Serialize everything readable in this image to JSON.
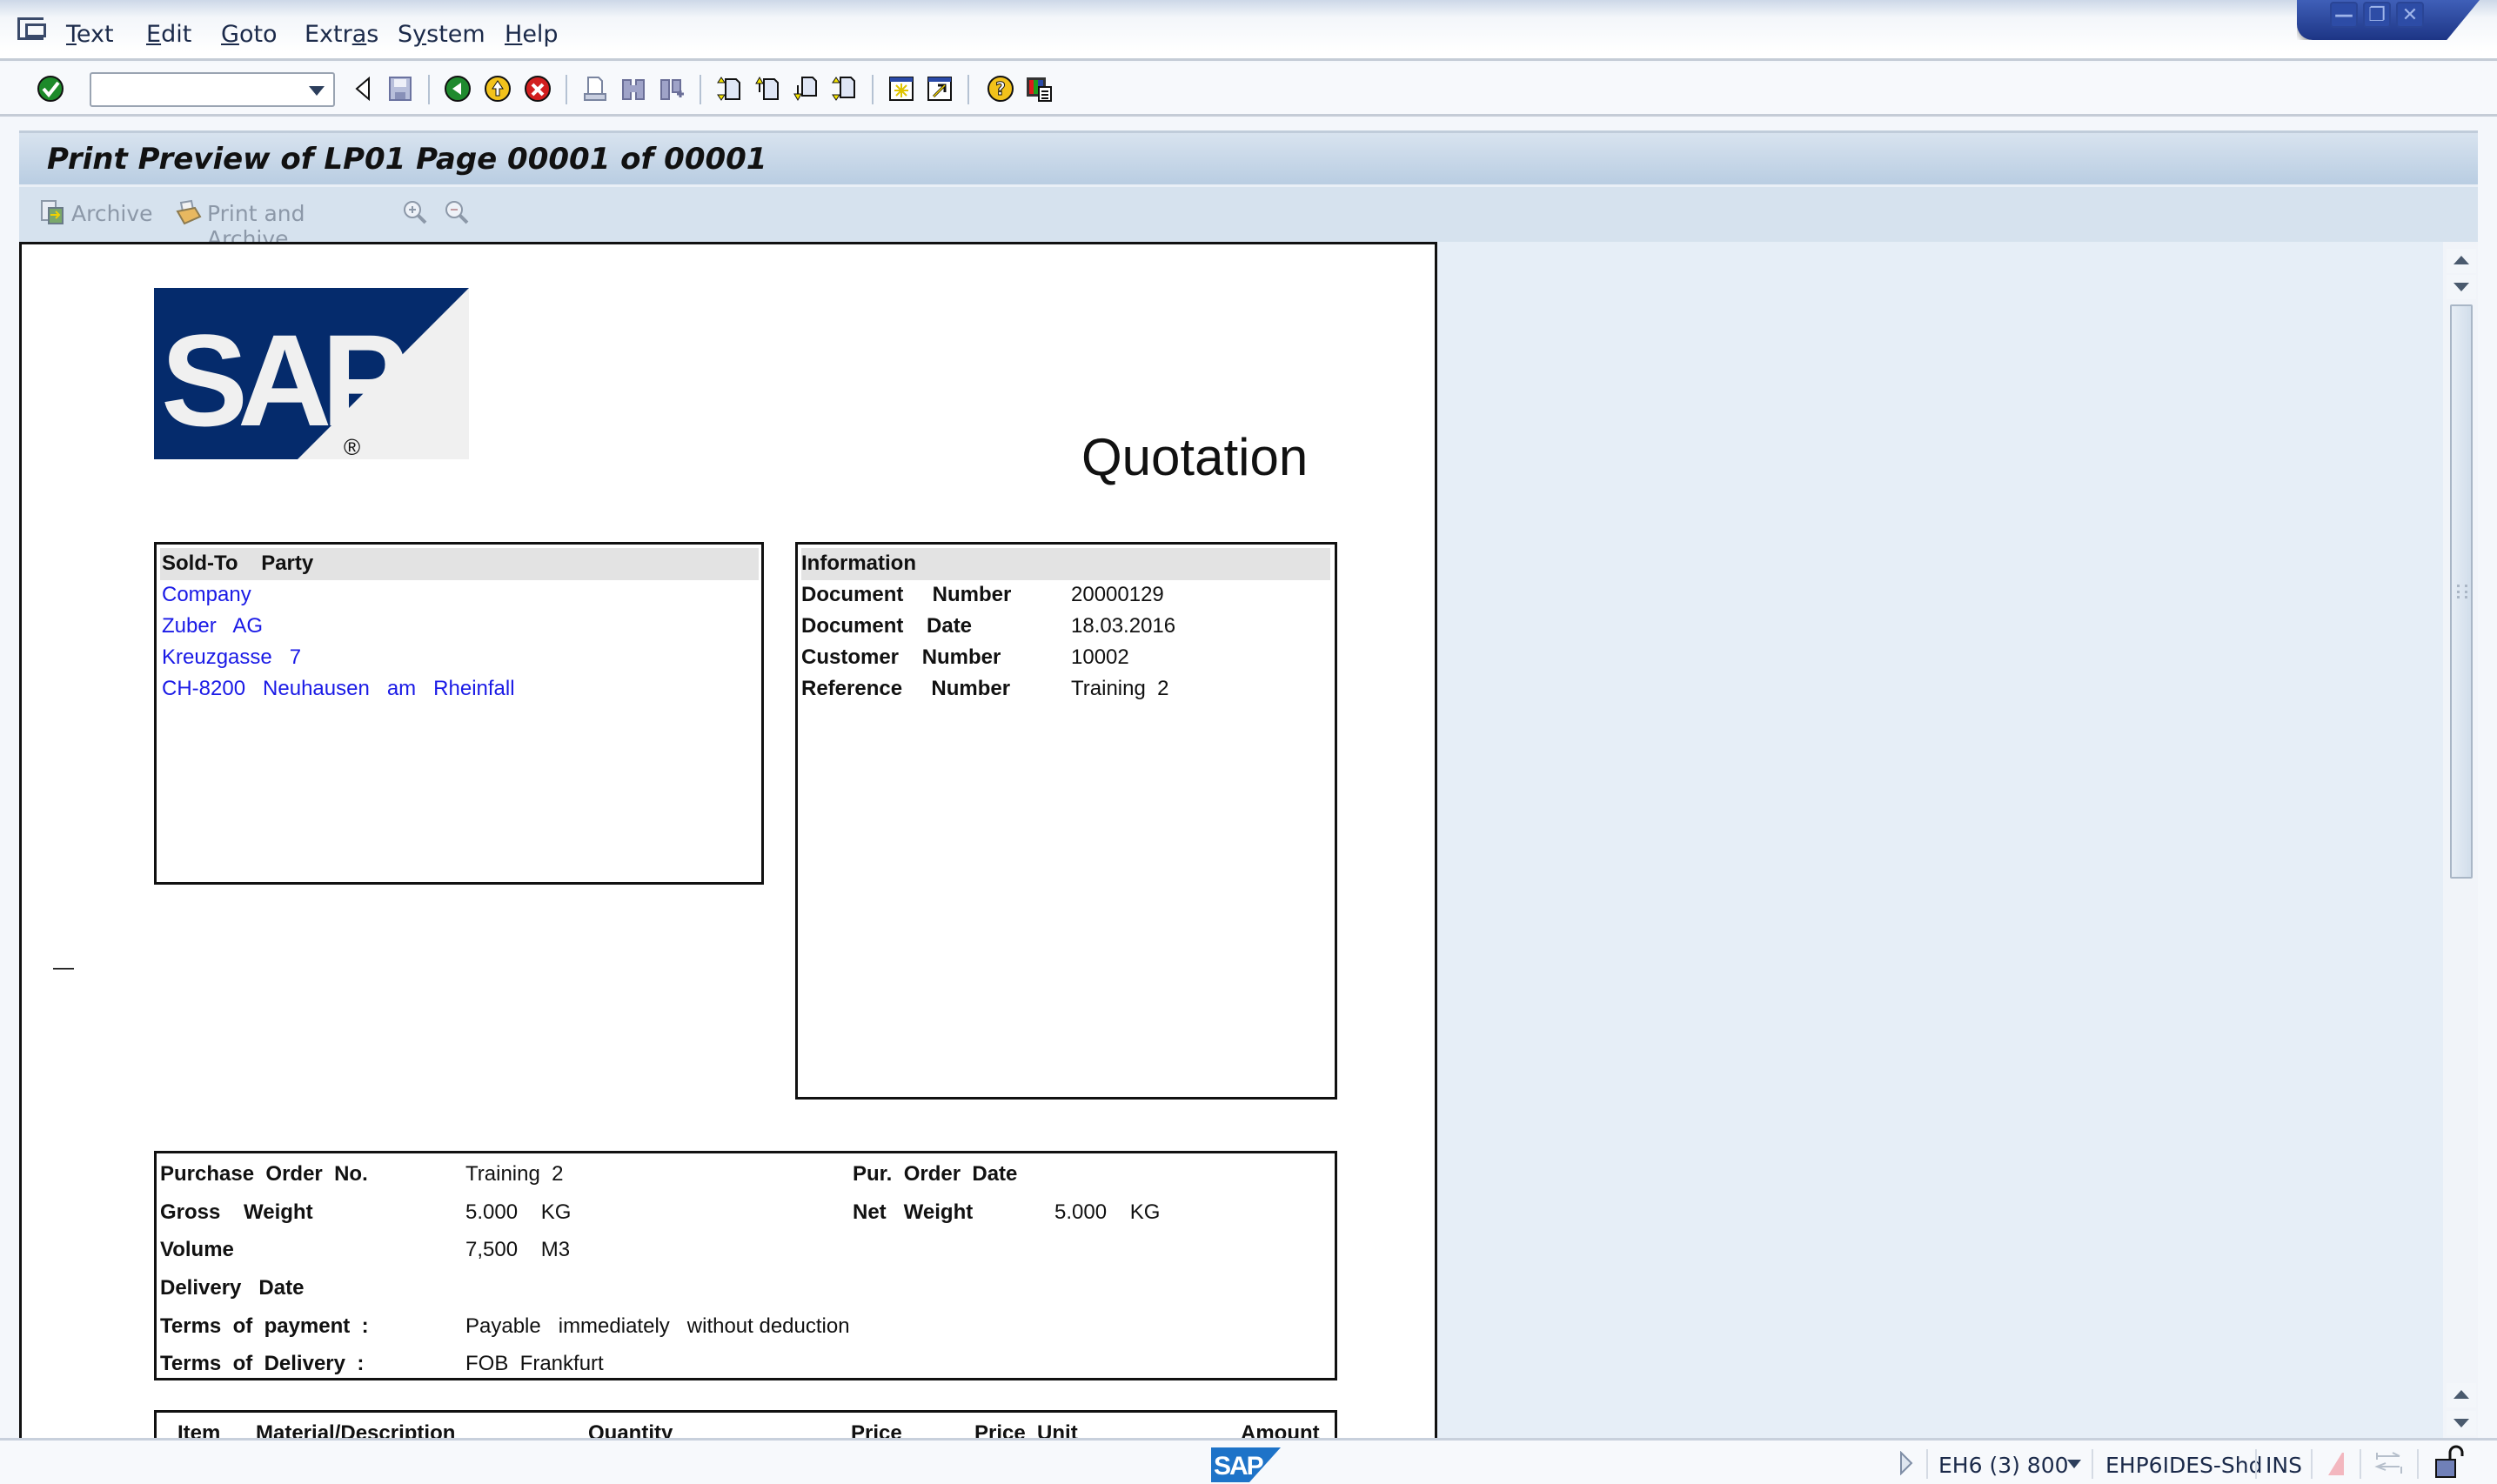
{
  "menubar": {
    "items": [
      {
        "label": "Text",
        "mnemonic": "T"
      },
      {
        "label": "Edit",
        "mnemonic": "E"
      },
      {
        "label": "Goto",
        "mnemonic": "G"
      },
      {
        "label": "Extras",
        "mnemonic": "a"
      },
      {
        "label": "System",
        "mnemonic": "y"
      },
      {
        "label": "Help",
        "mnemonic": "H"
      }
    ]
  },
  "window_controls": {
    "minimize": "—",
    "restore": "❐",
    "close": "✕"
  },
  "toolbar": {
    "command_field_value": "",
    "icons": [
      "enter-icon",
      "back-nav-icon",
      "save-icon",
      "back-icon",
      "exit-icon",
      "cancel-icon",
      "print-icon",
      "find-icon",
      "find-next-icon",
      "first-page-icon",
      "previous-page-icon",
      "next-page-icon",
      "last-page-icon",
      "create-session-icon",
      "shortcut-icon",
      "help-icon",
      "layout-icon"
    ]
  },
  "title": "Print Preview of LP01 Page 00001 of 00001",
  "app_toolbar": {
    "archive_label": "Archive",
    "print_archive_label": "Print and Archive"
  },
  "document": {
    "logo_text": "SAP",
    "logo_registered": "®",
    "heading": "Quotation",
    "sold_to": {
      "header": "Sold-To    Party",
      "lines": [
        "Company",
        "Zuber   AG",
        "Kreuzgasse   7",
        "CH-8200   Neuhausen   am   Rheinfall"
      ]
    },
    "information": {
      "header": "Information",
      "rows": [
        {
          "label": "Document     Number",
          "value": "20000129"
        },
        {
          "label": "Document    Date",
          "value": "18.03.2016"
        },
        {
          "label": "Customer    Number",
          "value": "10002"
        },
        {
          "label": "Reference     Number",
          "value": "Training  2"
        }
      ]
    },
    "margin_mark": "—",
    "order_details": {
      "purchase_order_no_label": "Purchase  Order  No.",
      "purchase_order_no_value": "Training  2",
      "pur_order_date_label": "Pur.  Order  Date",
      "pur_order_date_value": "",
      "gross_weight_label": "Gross    Weight",
      "gross_weight_value": "5.000    KG",
      "net_weight_label": "Net   Weight",
      "net_weight_value": "5.000    KG",
      "volume_label": "Volume",
      "volume_value": "7,500    M3",
      "delivery_date_label": "Delivery   Date",
      "delivery_date_value": "",
      "terms_payment_label": "Terms  of  payment  :",
      "terms_payment_value": "Payable   immediately   without deduction",
      "terms_delivery_label": "Terms  of  Delivery  :",
      "terms_delivery_value": "FOB  Frankfurt"
    },
    "items_table": {
      "columns": [
        "Item",
        "Material/Description",
        "Quantity",
        "Price",
        "Price  Unit",
        "Amount"
      ]
    }
  },
  "statusbar": {
    "system": "EH6 (3) 800",
    "server": "EHP6IDES-Shd",
    "mode": "INS"
  }
}
